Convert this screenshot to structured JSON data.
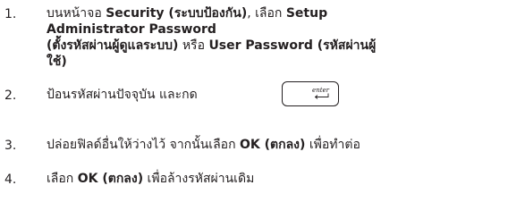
{
  "steps": [
    {
      "number": "1.",
      "line1_pre": "บนหน้าจอ ",
      "line1_bold": "Security (ระบบป้องกัน)",
      "line1_mid": ", เลือก ",
      "line1_bold2": "Setup",
      "line2_bold": "Administrator Password",
      "line3_bold": "(ตั้งรหัสผ่านผู้ดูแลระบบ)",
      "line3_mid": " หรือ ",
      "line3_bold2": "User Password (รหัสผ่านผู้",
      "line4_bold": "ใช้)"
    },
    {
      "number": "2.",
      "text": "ป้อนรหัสผ่านปัจจุบัน และกด",
      "key_label": "enter"
    },
    {
      "number": "3.",
      "pre": "ปล่อยฟิลด์อื่นให้ว่างไว้ จากนั้นเลือก ",
      "bold": "OK (ตกลง)",
      "post": " เพื่อทำต่อ"
    },
    {
      "number": "4.",
      "pre": "เลือก ",
      "bold": "OK (ตกลง)",
      "post": " เพื่อล้างรหัสผ่านเดิม"
    }
  ]
}
